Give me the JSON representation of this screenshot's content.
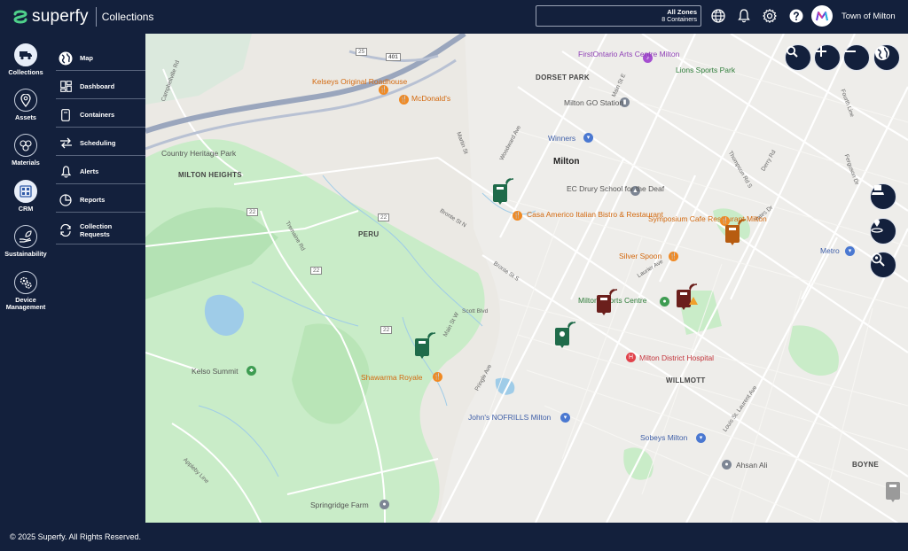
{
  "app": {
    "brand": "superfy",
    "product": "Collections"
  },
  "header": {
    "zones_title": "All Zones",
    "zones_subtitle": "8 Containers",
    "org_name": "Town of Milton"
  },
  "rail": [
    {
      "label": "Collections",
      "icon": "truck-icon"
    },
    {
      "label": "Assets",
      "icon": "map-pin-icon"
    },
    {
      "label": "Materials",
      "icon": "materials-icon"
    },
    {
      "label": "CRM",
      "icon": "crm-icon"
    },
    {
      "label": "Sustainability",
      "icon": "leaf-hand-icon"
    },
    {
      "label": "Device Management",
      "icon": "gears-icon"
    }
  ],
  "submenu": [
    {
      "label": "Map",
      "icon": "globe-icon"
    },
    {
      "label": "Dashboard",
      "icon": "dashboard-icon"
    },
    {
      "label": "Containers",
      "icon": "container-icon"
    },
    {
      "label": "Scheduling",
      "icon": "scheduling-icon",
      "chevron": "›"
    },
    {
      "label": "Alerts",
      "icon": "bell-icon"
    },
    {
      "label": "Reports",
      "icon": "reports-icon",
      "chevron": "›"
    },
    {
      "label": "Collection Requests",
      "icon": "requests-icon"
    }
  ],
  "map": {
    "areas": [
      "DORSET PARK",
      "MILTON HEIGHTS",
      "PERU",
      "WILLMOTT",
      "BOYNE"
    ],
    "city": "Milton",
    "pois": {
      "firstontario": "FirstOntario Arts Centre Milton",
      "lions": "Lions Sports Park",
      "kelseys": "Kelseys Original Roadhouse",
      "mcdonalds": "McDonald's",
      "go_station": "Milton GO Station",
      "winners": "Winners",
      "country_heritage": "Country Heritage Park",
      "ec_drury": "EC Drury School for the Deaf",
      "casa_americo": "Casa Americo Italian Bistro & Restaurant",
      "symposium": "Symposium Cafe Restaurant Milton",
      "silver_spoon": "Silver Spoon",
      "metro": "Metro",
      "sports_centre": "Milton Sports Centre",
      "hospital": "Milton District Hospital",
      "kelso": "Kelso Summit",
      "shawarma": "Shawarma Royale",
      "nofrills": "John's NOFRILLS Milton",
      "sobeys": "Sobeys Milton",
      "ahsan": "Ahsan Ali",
      "springridge": "Springridge Farm"
    },
    "roads": {
      "hwy401": "401",
      "r25": "25",
      "r22a": "22",
      "r22b": "22",
      "r22c": "22",
      "r22d": "22",
      "campbellville": "Campbellville Rd",
      "tremaine": "Tremaine Rd",
      "appleby": "Appleby Line",
      "main_w": "Main St W",
      "scott": "Scott Blvd",
      "pringle": "Pringle Ave",
      "bronte_n": "Bronte St N",
      "bronte_s": "Bronte St S",
      "woodward": "Woodward Ave",
      "martin": "Martin St",
      "thompson": "Thompson Rd S",
      "laurier": "Laurier Ave",
      "louis": "Louis St. Laurent Ave",
      "fourth": "Fourth Line",
      "derry": "Derry Rd",
      "yates": "Yates Dr",
      "ferguson": "Ferguson Dr",
      "main_e": "Main St E"
    }
  },
  "footer": {
    "copyright": "© 2025 Superfy. All Rights Reserved."
  },
  "colors": {
    "nav_bg": "#13203c",
    "park_green": "#c8ebc9",
    "bin_green": "#1f6b4a",
    "bin_brown": "#6b1f1c",
    "bin_orange": "#b75c10"
  }
}
